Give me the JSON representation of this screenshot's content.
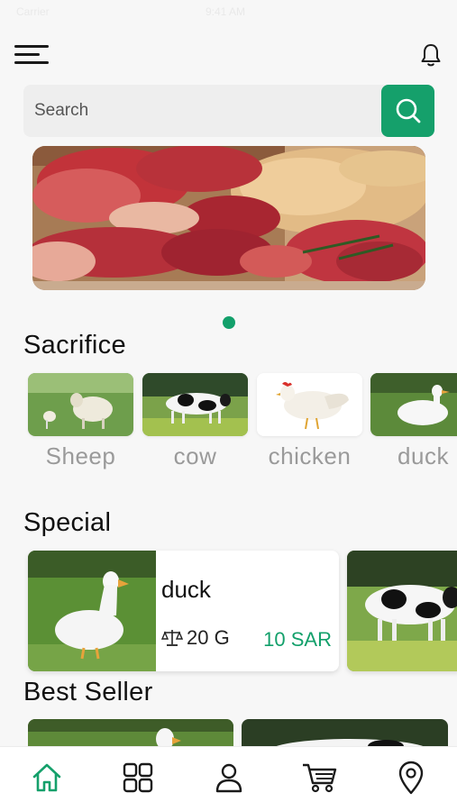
{
  "status": {
    "carrier": "Carrier",
    "time": "9:41 AM"
  },
  "search": {
    "placeholder": "Search"
  },
  "sections": {
    "sacrifice": "Sacrifice",
    "special": "Special",
    "best_seller": "Best Seller"
  },
  "categories": [
    {
      "label": "Sheep"
    },
    {
      "label": "cow"
    },
    {
      "label": "chicken"
    },
    {
      "label": "duck"
    }
  ],
  "special_items": [
    {
      "name": "duck",
      "weight": "20 G",
      "price": "10 SAR"
    }
  ],
  "colors": {
    "accent": "#15a06b",
    "price": "#13a06b"
  },
  "nav": [
    "home-icon",
    "grid-icon",
    "profile-icon",
    "cart-icon",
    "location-icon"
  ]
}
